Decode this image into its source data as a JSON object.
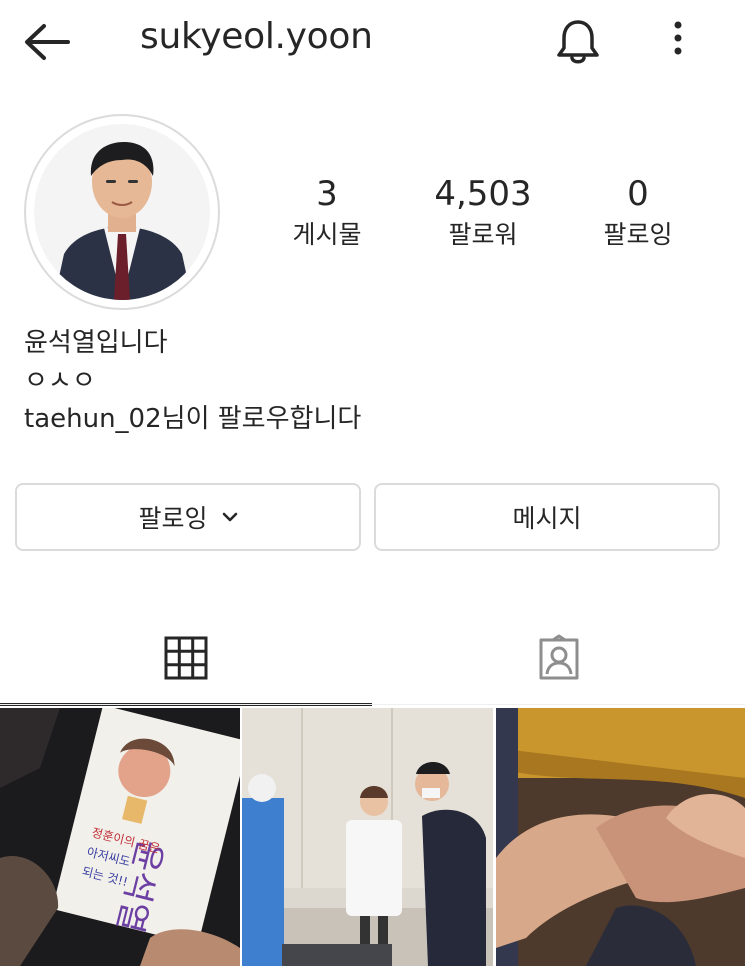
{
  "header": {
    "username": "sukyeol.yoon",
    "back_icon": "arrow-left-icon",
    "bell_icon": "bell-icon",
    "more_icon": "more-vertical-icon"
  },
  "profile": {
    "avatar_icon": "profile-photo",
    "stats": [
      {
        "value": "3",
        "label": "게시물"
      },
      {
        "value": "4,503",
        "label": "팔로워"
      },
      {
        "value": "0",
        "label": "팔로잉"
      }
    ],
    "bio": {
      "name": "윤석열입니다",
      "text": "ㅇㅅㅇ",
      "followed_by_user": "taehun_02",
      "followed_by_suffix": "님이 팔로우합니다"
    }
  },
  "actions": {
    "following_label": "팔로잉",
    "message_label": "메시지"
  },
  "tabs": [
    {
      "name": "grid",
      "icon": "grid-icon",
      "active": true
    },
    {
      "name": "tagged",
      "icon": "tagged-person-icon",
      "active": false
    }
  ],
  "posts": [
    {
      "alt": "child-drawing-photo"
    },
    {
      "alt": "medical-staff-photo"
    },
    {
      "alt": "hands-photo"
    }
  ],
  "colors": {
    "text": "#262626",
    "border": "#dbdbdb",
    "background": "#ffffff"
  }
}
